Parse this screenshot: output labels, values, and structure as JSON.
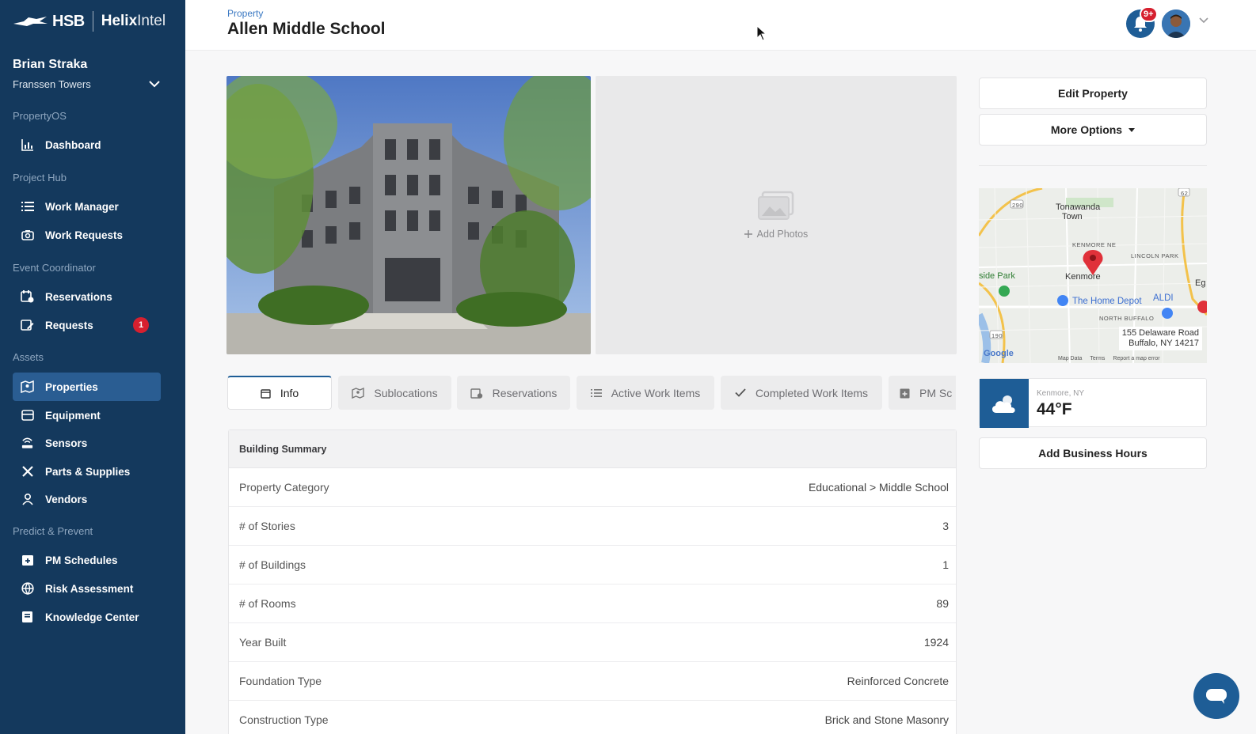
{
  "brand": {
    "hsb": "HSB",
    "helix_bold": "Helix",
    "helix_light": "Intel"
  },
  "user": {
    "name": "Brian Straka",
    "org": "Franssen Towers"
  },
  "nav": {
    "sections": {
      "propertyos": "PropertyOS",
      "project_hub": "Project Hub",
      "event_coordinator": "Event Coordinator",
      "assets": "Assets",
      "predict_prevent": "Predict & Prevent"
    },
    "items": {
      "dashboard": "Dashboard",
      "work_manager": "Work Manager",
      "work_requests": "Work Requests",
      "reservations": "Reservations",
      "requests": "Requests",
      "requests_badge": "1",
      "properties": "Properties",
      "equipment": "Equipment",
      "sensors": "Sensors",
      "parts_supplies": "Parts & Supplies",
      "vendors": "Vendors",
      "pm_schedules": "PM Schedules",
      "risk_assessment": "Risk Assessment",
      "knowledge_center": "Knowledge Center"
    }
  },
  "header": {
    "breadcrumb": "Property",
    "title": "Allen Middle School",
    "notification_badge": "9+"
  },
  "photos": {
    "add_label": "Add Photos"
  },
  "tabs": [
    {
      "label": "Info",
      "icon": "calendar-icon"
    },
    {
      "label": "Sublocations",
      "icon": "map-icon"
    },
    {
      "label": "Reservations",
      "icon": "calendar-clock-icon"
    },
    {
      "label": "Active Work Items",
      "icon": "list-icon"
    },
    {
      "label": "Completed Work Items",
      "icon": "check-icon"
    },
    {
      "label": "PM Sc",
      "icon": "calendar-plus-icon"
    }
  ],
  "info": {
    "section_title": "Building Summary",
    "rows": [
      {
        "label": "Property Category",
        "value": "Educational > Middle School"
      },
      {
        "label": "# of Stories",
        "value": "3"
      },
      {
        "label": "# of Buildings",
        "value": "1"
      },
      {
        "label": "# of Rooms",
        "value": "89"
      },
      {
        "label": "Year Built",
        "value": "1924"
      },
      {
        "label": "Foundation Type",
        "value": "Reinforced Concrete"
      },
      {
        "label": "Construction Type",
        "value": "Brick and Stone Masonry"
      }
    ]
  },
  "actions": {
    "edit_property": "Edit Property",
    "more_options": "More Options",
    "add_business_hours": "Add Business Hours"
  },
  "map": {
    "address_line1": "155 Delaware Road",
    "address_line2": "Buffalo, NY 14217",
    "labels": {
      "tonawanda": "Tonawanda",
      "town": "Town",
      "kenmore_ne": "KENMORE NE",
      "lincoln_park": "LINCOLN PARK",
      "side_park": "side Park",
      "kenmore": "Kenmore",
      "eg": "Eg",
      "home_depot": "The Home Depot",
      "aldi": "ALDI",
      "north_buffalo": "NORTH BUFFALO",
      "google": "Google",
      "route_62": "62",
      "route_290": "290",
      "route_190": "190"
    },
    "footer": {
      "map_data": "Map Data",
      "terms": "Terms",
      "report": "Report a map error"
    }
  },
  "weather": {
    "location": "Kenmore, NY",
    "temperature": "44°F"
  },
  "colors": {
    "sidebar": "#14395d",
    "accent": "#1e5d96",
    "active_nav": "#2a5d92",
    "badge": "#d6202f"
  }
}
